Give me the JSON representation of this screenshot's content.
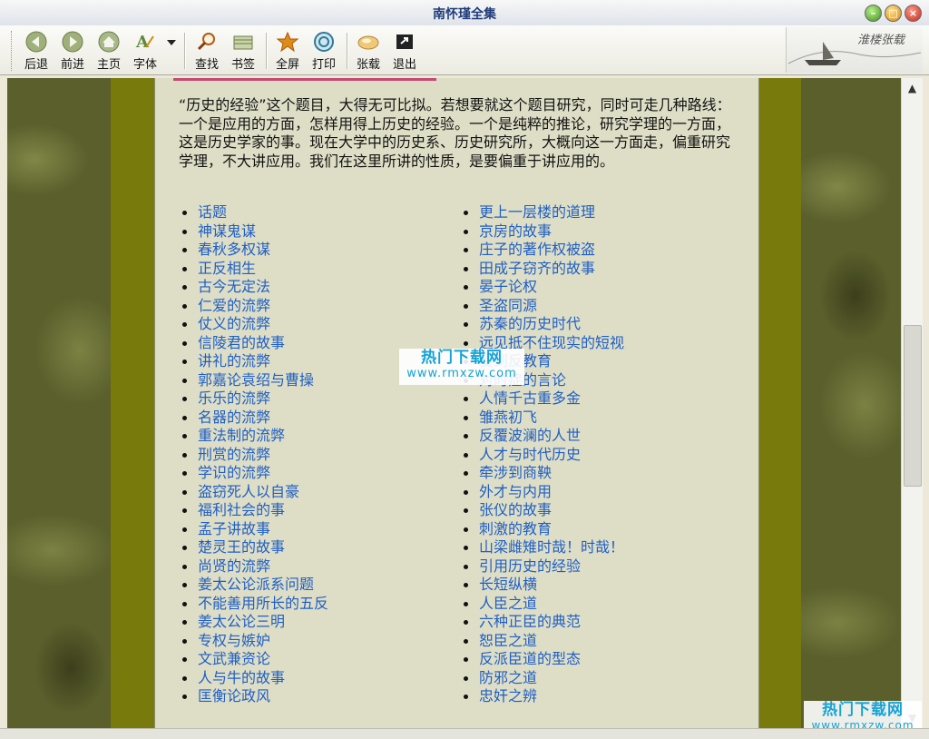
{
  "window": {
    "title": "南怀瑾全集"
  },
  "toolbar": {
    "buttons": [
      {
        "label": "后退",
        "icon": "back-arrow-icon"
      },
      {
        "label": "前进",
        "icon": "forward-arrow-icon"
      },
      {
        "label": "主页",
        "icon": "home-icon"
      },
      {
        "label": "字体",
        "icon": "font-icon"
      },
      {
        "label": "查找",
        "icon": "search-icon"
      },
      {
        "label": "书签",
        "icon": "bookmark-icon"
      },
      {
        "label": "全屏",
        "icon": "fullscreen-icon"
      },
      {
        "label": "打印",
        "icon": "print-icon"
      },
      {
        "label": "张载",
        "icon": "zhangzai-icon"
      },
      {
        "label": "退出",
        "icon": "exit-icon"
      }
    ]
  },
  "article": {
    "intro": "“历史的经验”这个题目，大得无可比拟。若想要就这个题目研究，同时可走几种路线：一个是应用的方面，怎样用得上历史的经验。一个是纯粹的推论，研究学理的一方面，这是历史学家的事。现在大学中的历史系、历史研究所，大概向这一方面走，偏重研究学理，不大讲应用。我们在这里所讲的性质，是要偏重于讲应用的。"
  },
  "list_left": [
    "话题",
    "神谋鬼谋",
    "春秋多权谋",
    "正反相生",
    "古今无定法",
    "仁爱的流弊",
    "仗义的流弊",
    "信陵君的故事",
    "讲礼的流弊",
    "郭嘉论袁绍与曹操",
    "乐乐的流弊",
    "名器的流弊",
    "重法制的流弊",
    "刑赏的流弊",
    "学识的流弊",
    "盗窃死人以自豪",
    "福利社会的事",
    "孟子讲故事",
    "楚灵王的故事",
    "尚贤的流弊",
    "姜太公论派系问题",
    "不能善用所长的五反",
    "姜太公论三明",
    "专权与嫉妒",
    "文武兼资论",
    "人与牛的故事",
    "匡衡论政风"
  ],
  "list_right": [
    "更上一层楼的道理",
    "京房的故事",
    "庄子的著作权被盗",
    "田成子窃齐的故事",
    "晏子论权",
    "圣盗同源",
    "苏秦的历史时代",
    "远见抵不住现实的短视",
    "受到反教育",
    "对时症的言论",
    "人情千古重多金",
    "雏燕初飞",
    "反覆波澜的人世",
    "人才与时代历史",
    "牵涉到商鞅",
    "外才与内用",
    "张仪的故事",
    "刺激的教育",
    "山梁雌雉时哉！时哉！",
    "引用历史的经验",
    "长短纵横",
    "人臣之道",
    "六种正臣的典范",
    "恕臣之道",
    "反派臣道的型态",
    "防邪之道",
    "忠奸之辨"
  ],
  "watermark": {
    "title": "热门下载网",
    "url": "www.rmxzw.com"
  },
  "logo": {
    "text": "淮楼张载"
  }
}
